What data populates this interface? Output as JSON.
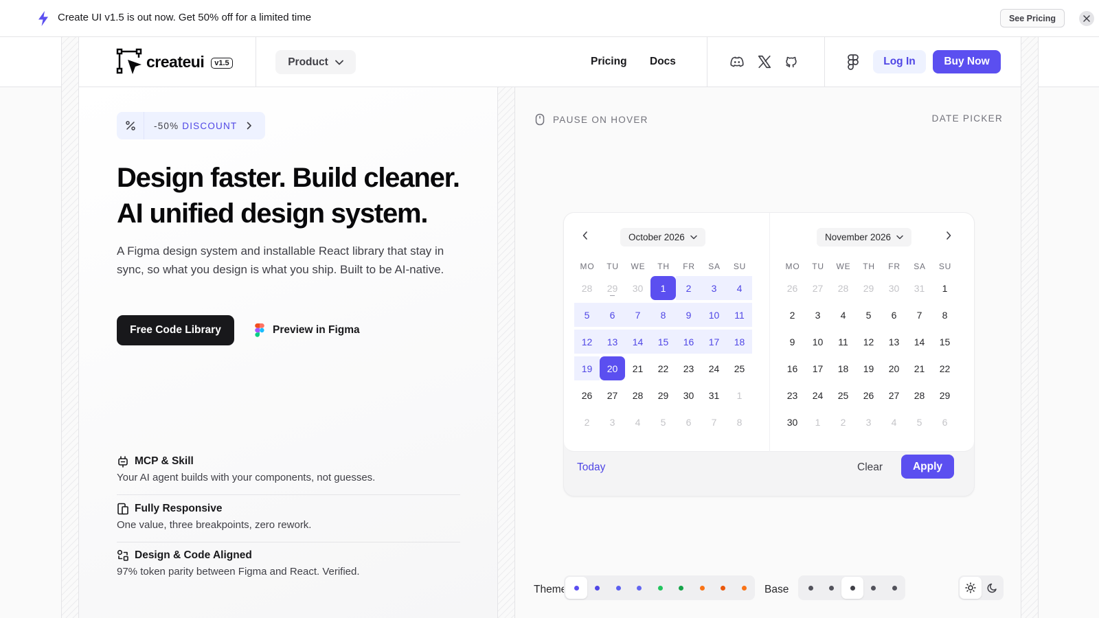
{
  "announcement": {
    "message": "Create UI v1.5 is out now. Get 50% off for a limited time",
    "cta": "See Pricing",
    "accent": "#5b4ff0"
  },
  "nav": {
    "logo_text": "createui",
    "version": "v1.5",
    "product_label": "Product",
    "links": [
      "Pricing",
      "Docs"
    ],
    "social_icons": [
      "discord-icon",
      "x-icon",
      "github-icon"
    ],
    "figma_icon": "figma-icon",
    "login_label": "Log In",
    "buy_label": "Buy Now"
  },
  "hero": {
    "discount_prefix": "-50%",
    "discount_word": "DISCOUNT",
    "headline_line1": "Design faster. Build cleaner.",
    "headline_line2": "AI unified design system.",
    "subtitle": "A Figma design system and installable React library that stay in sync, so what you design is what you ship. Built to be AI-native.",
    "primary_cta": "Free Code Library",
    "secondary_cta": "Preview in Figma"
  },
  "features": [
    {
      "icon": "plug-icon",
      "title": "MCP & Skill",
      "desc": "Your AI agent builds with your components, not guesses."
    },
    {
      "icon": "devices-icon",
      "title": "Fully Responsive",
      "desc": "One value, three breakpoints, zero rework."
    },
    {
      "icon": "layout-icon",
      "title": "Design & Code Aligned",
      "desc": "97% token parity between Figma and React. Verified."
    }
  ],
  "showcase": {
    "pause_label": "PAUSE ON HOVER",
    "section_label": "DATE PICKER",
    "theme_label": "Theme",
    "base_label": "Base",
    "theme_colors": [
      "#5b4ff0",
      "#4f46e5",
      "#5b5ff0",
      "#6366f1",
      "#22c55e",
      "#16a34a",
      "#f97316",
      "#ea580c",
      "#f97316"
    ],
    "base_colors": [
      "#52525b",
      "#52525b",
      "#3f3f46",
      "#52525b",
      "#52525b"
    ]
  },
  "calendar": {
    "weekdays": [
      "MO",
      "TU",
      "WE",
      "TH",
      "FR",
      "SA",
      "SU"
    ],
    "months": [
      {
        "label": "October 2026",
        "days": [
          [
            "28",
            "29",
            "30",
            "1",
            "2",
            "3",
            "4"
          ],
          [
            "5",
            "6",
            "7",
            "8",
            "9",
            "10",
            "11"
          ],
          [
            "12",
            "13",
            "14",
            "15",
            "16",
            "17",
            "18"
          ],
          [
            "19",
            "20",
            "21",
            "22",
            "23",
            "24",
            "25"
          ],
          [
            "26",
            "27",
            "28",
            "29",
            "30",
            "31",
            "1"
          ],
          [
            "2",
            "3",
            "4",
            "5",
            "6",
            "7",
            "8"
          ]
        ]
      },
      {
        "label": "November 2026",
        "days": [
          [
            "26",
            "27",
            "28",
            "29",
            "30",
            "31",
            "1"
          ],
          [
            "2",
            "3",
            "4",
            "5",
            "6",
            "7",
            "8"
          ],
          [
            "9",
            "10",
            "11",
            "12",
            "13",
            "14",
            "15"
          ],
          [
            "16",
            "17",
            "18",
            "19",
            "20",
            "21",
            "22"
          ],
          [
            "23",
            "24",
            "25",
            "26",
            "27",
            "28",
            "29"
          ],
          [
            "30",
            "1",
            "2",
            "3",
            "4",
            "5",
            "6"
          ]
        ]
      }
    ],
    "today_label": "Today",
    "clear_label": "Clear",
    "apply_label": "Apply"
  }
}
